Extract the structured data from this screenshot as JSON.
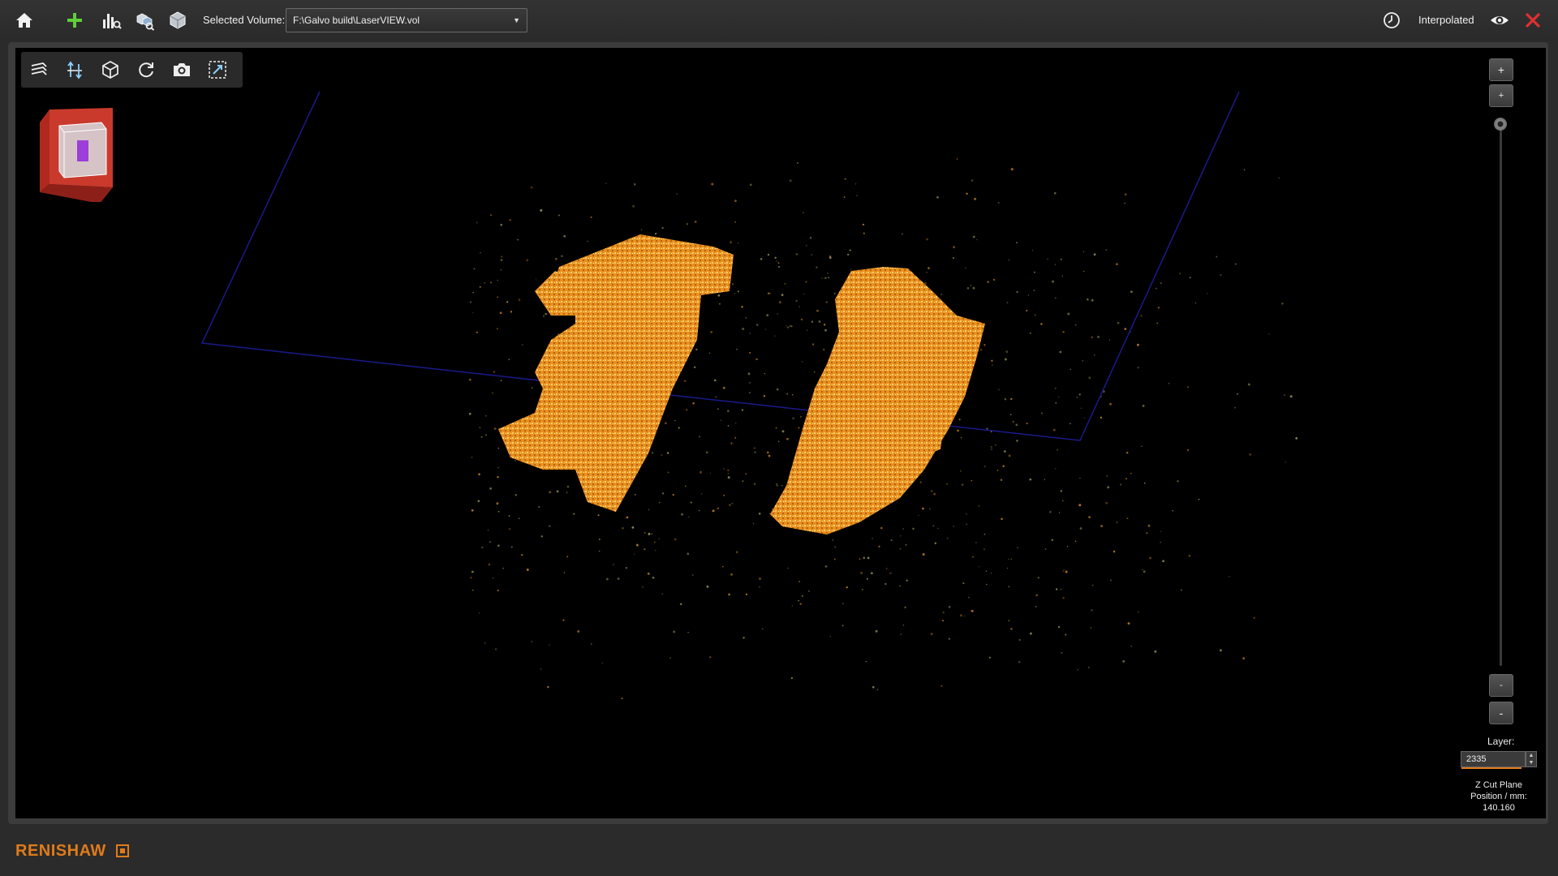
{
  "toolbar": {
    "home_icon": "home-icon",
    "add_icon": "plus-icon",
    "analysis_icon": "chart-search-icon",
    "volume_search_icon": "cubes-search-icon",
    "volume_icon": "cube-icon",
    "selected_volume_label": "Selected Volume:",
    "selected_volume_value": "F:\\Galvo build\\LaserVIEW.vol",
    "history_icon": "clock-icon",
    "mode_label": "Interpolated",
    "visibility_icon": "eye-icon",
    "close_icon": "close-icon"
  },
  "view_toolbar": {
    "items": [
      "slice-planes-icon",
      "axis-arrows-icon",
      "iso-cube-icon",
      "rotate-icon",
      "camera-icon",
      "fit-view-icon"
    ]
  },
  "zoom": {
    "in_large": "+",
    "in_small": "+",
    "out_small": "-",
    "out_large": "-",
    "level": 0.0
  },
  "layer": {
    "label": "Layer:",
    "value": "2335",
    "spin_up": "▲",
    "spin_down": "▼"
  },
  "zcut": {
    "line1": "Z Cut Plane",
    "line2": "Position / mm:",
    "value": "140.160"
  },
  "footer": {
    "brand": "RENISHAW"
  },
  "colors": {
    "accent": "#e07b1a",
    "plane": "#1a1a8c",
    "add_green": "#5fcf3a",
    "close_red": "#e03030",
    "point_orange": "#f0a030"
  }
}
